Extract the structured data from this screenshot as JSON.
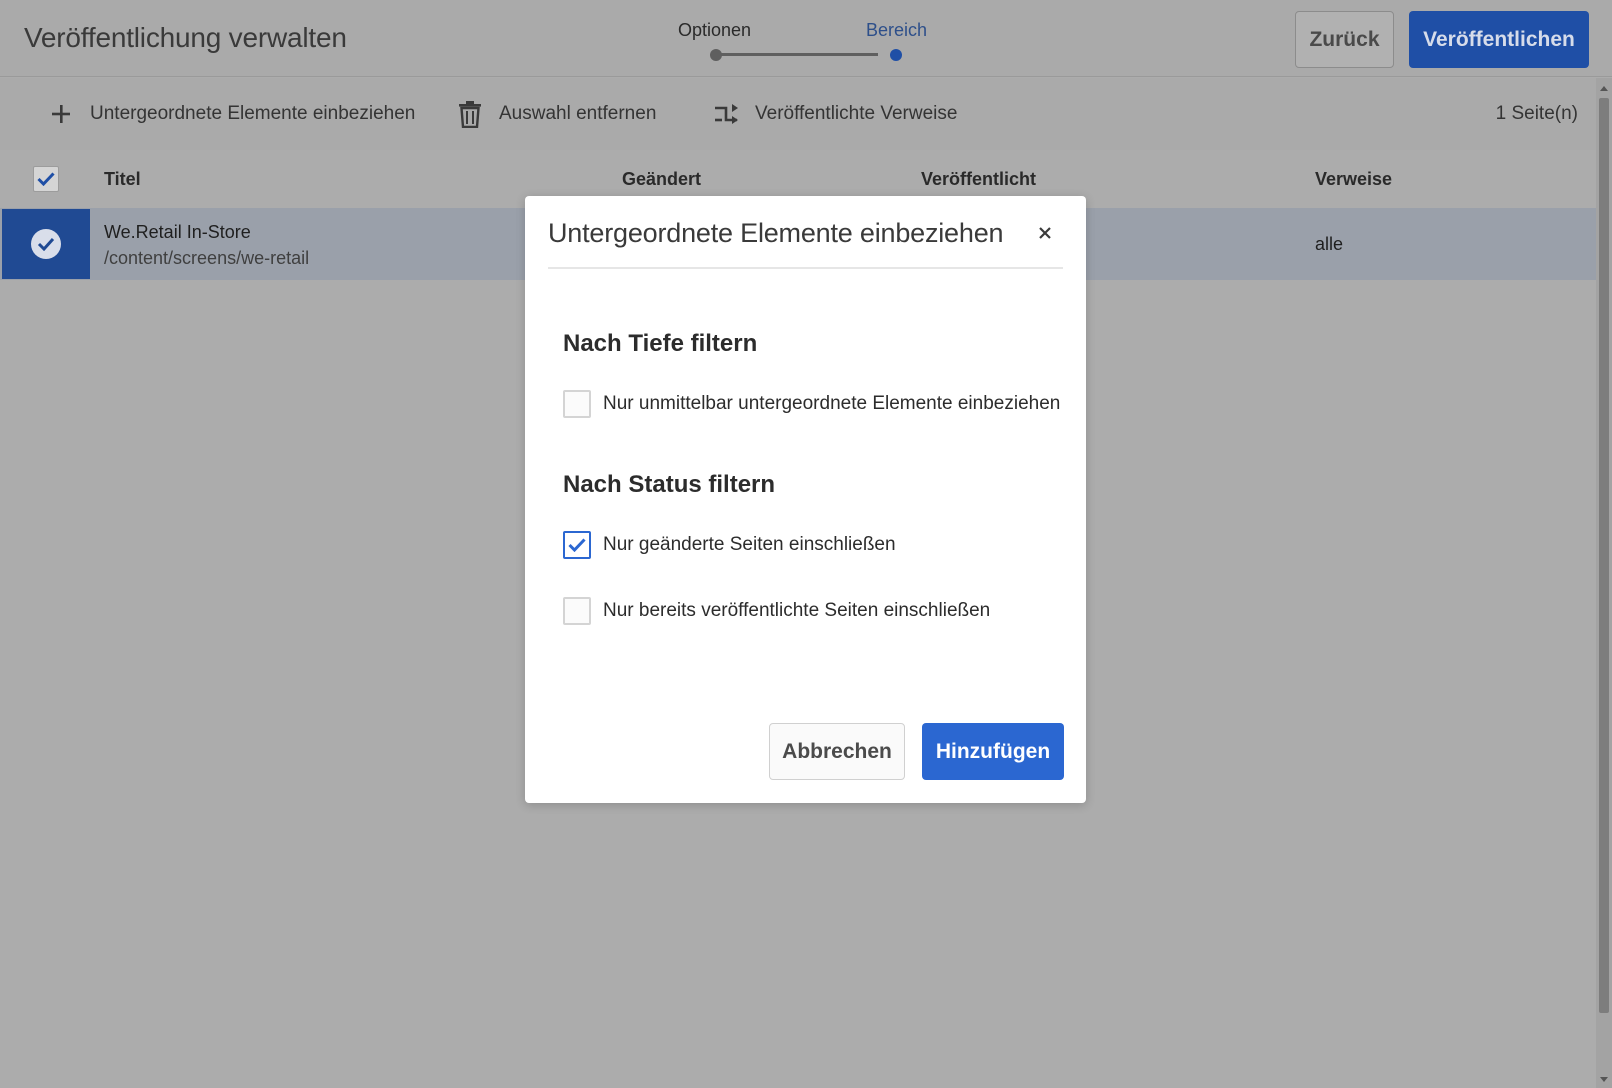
{
  "header": {
    "title": "Veröffentlichung verwalten",
    "steps": [
      {
        "label": "Optionen",
        "state": "done"
      },
      {
        "label": "Bereich",
        "state": "current"
      }
    ],
    "back_label": "Zurück",
    "publish_label": "Veröffentlichen"
  },
  "toolbar": {
    "include_children_label": "Untergeordnete Elemente einbeziehen",
    "remove_selection_label": "Auswahl entfernen",
    "published_references_label": "Veröffentlichte Verweise",
    "page_count": "1 Seite(n)"
  },
  "table": {
    "columns": {
      "title": "Titel",
      "modified": "Geändert",
      "published": "Veröffentlicht",
      "references": "Verweise"
    },
    "rows": [
      {
        "title": "We.Retail In-Store",
        "path": "/content/screens/we-retail",
        "references": "alle",
        "selected": true
      }
    ]
  },
  "dialog": {
    "title": "Untergeordnete Elemente einbeziehen",
    "depth_heading": "Nach Tiefe filtern",
    "status_heading": "Nach Status filtern",
    "options": [
      {
        "label": "Nur unmittelbar untergeordnete Elemente einbeziehen",
        "checked": false
      },
      {
        "label": "Nur geänderte Seiten einschließen",
        "checked": true
      },
      {
        "label": "Nur bereits veröffentlichte Seiten einschließen",
        "checked": false
      }
    ],
    "cancel_label": "Abbrechen",
    "add_label": "Hinzufügen"
  },
  "colors": {
    "accent": "#2b67d1",
    "overlay": "#acacac",
    "selected_row": "#9aa0aa"
  }
}
